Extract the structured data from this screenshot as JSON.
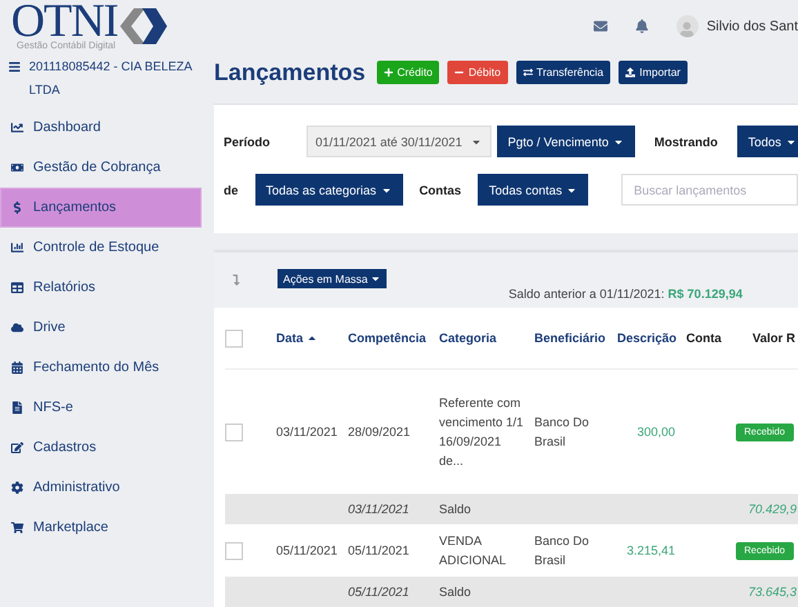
{
  "logo": {
    "name": "OTNI",
    "tagline": "Gestão Contábil Digital"
  },
  "header": {
    "user": "Silvio dos Sant"
  },
  "company": "201118085442 - CIA BELEZA LTDA",
  "sidebar": {
    "items": [
      {
        "label": "Dashboard",
        "selected": false
      },
      {
        "label": "Gestão de Cobrança",
        "selected": false
      },
      {
        "label": "Lançamentos",
        "selected": true
      },
      {
        "label": "Controle de Estoque",
        "selected": false
      },
      {
        "label": "Relatórios",
        "selected": false
      },
      {
        "label": "Drive",
        "selected": false
      },
      {
        "label": "Fechamento do Mês",
        "selected": false
      },
      {
        "label": "NFS-e",
        "selected": false
      },
      {
        "label": "Cadastros",
        "selected": false
      },
      {
        "label": "Administrativo",
        "selected": false
      },
      {
        "label": "Marketplace",
        "selected": false
      }
    ]
  },
  "page_title": "Lançamentos",
  "actions": [
    {
      "label": "Crédito",
      "kind": "credit"
    },
    {
      "label": "Débito",
      "kind": "debit"
    },
    {
      "label": "Transferência",
      "kind": "transfer"
    },
    {
      "label": "Importar",
      "kind": "import"
    }
  ],
  "filters": {
    "period_label": "Período",
    "period_value": "01/11/2021 até 30/11/2021",
    "date_type": "Pgto / Vencimento",
    "showing_label": "Mostrando",
    "showing": "Todos",
    "category_label": "de",
    "category": "Todas as categorias",
    "accounts_label": "Contas",
    "accounts": "Todas contas",
    "search_placeholder": "Buscar lançamentos"
  },
  "bulk_actions": "Ações em Massa",
  "previous_balance": {
    "label": "Saldo anterior a 01/11/2021:",
    "value": "R$ 70.129,94"
  },
  "table": {
    "select_all_checked": false,
    "columns": [
      "Data",
      "Competência",
      "Categoria",
      "Beneficiário",
      "Descrição",
      "Conta",
      "Valor R"
    ],
    "rows": [
      {
        "kind": "entry",
        "checked": false,
        "date": "03/11/2021",
        "competence": "28/09/2021",
        "category": "Referente com vencimento 1/1 16/09/2021 de...",
        "payee": "Banco Do Brasil",
        "amount": "300,00",
        "status": "Recebido"
      },
      {
        "kind": "balance",
        "date": "03/11/2021",
        "label": "Saldo",
        "value": "70.429,9"
      },
      {
        "kind": "entry",
        "checked": false,
        "date": "05/11/2021",
        "competence": "05/11/2021",
        "category": "VENDA ADICIONAL",
        "payee": "Banco Do Brasil",
        "amount": "3.215,41",
        "status": "Recebido"
      },
      {
        "kind": "balance",
        "date": "05/11/2021",
        "label": "Saldo",
        "value": "73.645,3"
      }
    ]
  }
}
